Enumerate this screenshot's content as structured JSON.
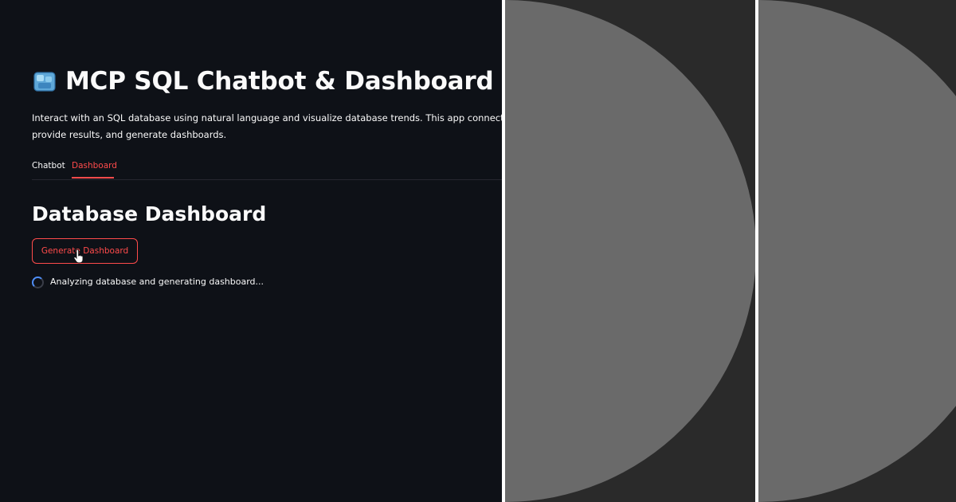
{
  "app": {
    "title": "MCP SQL Chatbot & Dashboard",
    "icon": "ice-cube-icon",
    "description_line1": "Interact with an SQL database using natural language and visualize database trends. This app connects to an M",
    "description_line2": "provide results, and generate dashboards."
  },
  "tabs": [
    {
      "label": "Chatbot",
      "active": false
    },
    {
      "label": "Dashboard",
      "active": true
    }
  ],
  "dashboard": {
    "heading": "Database Dashboard",
    "button_label": "Generate Dashboard",
    "status_text": "Analyzing database and generating dashboard..."
  },
  "colors": {
    "background": "#0e1117",
    "accent": "#ff4b4b",
    "spinner": "#4f8ef7",
    "side_panel": "#2a2a2a",
    "circle": "#6a6a6a"
  }
}
